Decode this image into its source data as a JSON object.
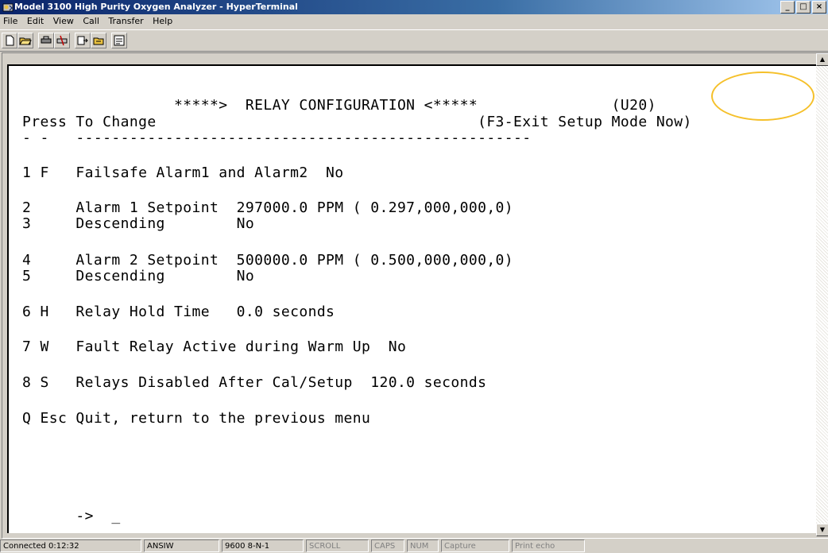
{
  "window": {
    "title": "Model 3100 High Purity Oxygen Analyzer - HyperTerminal",
    "minimize": "_",
    "maximize": "□",
    "close": "×"
  },
  "menu": [
    "File",
    "Edit",
    "View",
    "Call",
    "Transfer",
    "Help"
  ],
  "toolbar": {
    "icons": [
      "new-icon",
      "open-icon",
      "connect-icon",
      "disconnect-icon",
      "send-icon",
      "receive-icon",
      "properties-icon"
    ]
  },
  "terminal": {
    "lines": [
      "                 *****>  RELAY CONFIGURATION <*****               (U20)",
      "Press To Change                                    (F3-Exit Setup Mode Now)",
      "- -   ---------------------------------------------------",
      "1 F   Failsafe Alarm1 and Alarm2  No",
      "2     Alarm 1 Setpoint  297000.0 PPM ( 0.297,000,000,0)",
      "3     Descending        No",
      "4     Alarm 2 Setpoint  500000.0 PPM ( 0.500,000,000,0)",
      "5     Descending        No",
      "6 H   Relay Hold Time   0.0 seconds",
      "7 W   Fault Relay Active during Warm Up  No",
      "8 S   Relays Disabled After Cal/Setup  120.0 seconds",
      "Q Esc Quit, return to the previous menu",
      "      ->  _"
    ]
  },
  "statusbar": {
    "connected": "Connected 0:12:32",
    "emulation": "ANSIW",
    "port": "9600 8-N-1",
    "scroll": "SCROLL",
    "caps": "CAPS",
    "num": "NUM",
    "capture": "Capture",
    "print_echo": "Print echo"
  },
  "colors": {
    "title_active": "#0a246a",
    "highlight": "#f5c02a",
    "terminal_bg": "#ffffff"
  }
}
